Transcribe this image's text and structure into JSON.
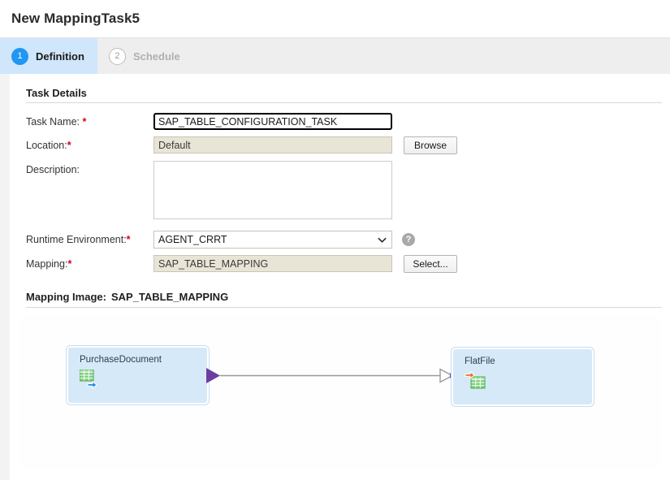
{
  "header": {
    "title": "New MappingTask5"
  },
  "steps": [
    {
      "num": "1",
      "label": "Definition",
      "state": "active"
    },
    {
      "num": "2",
      "label": "Schedule",
      "state": "inactive"
    }
  ],
  "task_details": {
    "section_title": "Task Details",
    "fields": {
      "task_name": {
        "label": "Task Name:",
        "required": "*",
        "value": "SAP_TABLE_CONFIGURATION_TASK",
        "placeholder": ""
      },
      "location": {
        "label": "Location:",
        "required": "*",
        "value": "Default",
        "browse_label": "Browse"
      },
      "description": {
        "label": "Description:",
        "value": "",
        "placeholder": ""
      },
      "runtime_environment": {
        "label": "Runtime Environment:",
        "required": "*",
        "value": "AGENT_CRRT",
        "help_glyph": "?"
      },
      "mapping": {
        "label": "Mapping:",
        "required": "*",
        "value": "SAP_TABLE_MAPPING",
        "select_label": "Select..."
      }
    }
  },
  "mapping_image": {
    "heading": "Mapping Image:",
    "name": "SAP_TABLE_MAPPING",
    "nodes": {
      "source": {
        "label": "PurchaseDocument",
        "icon": "source-table-icon"
      },
      "target": {
        "label": "FlatFile",
        "icon": "target-flatfile-icon"
      }
    }
  },
  "colors": {
    "accent_blue": "#2196f3",
    "step_active_bg": "#cfe6fb",
    "node_fill": "#d6e9f8",
    "connector_purple": "#6b3fa0",
    "required_red": "#d0021b",
    "readonly_beige": "#e9e5d6"
  }
}
